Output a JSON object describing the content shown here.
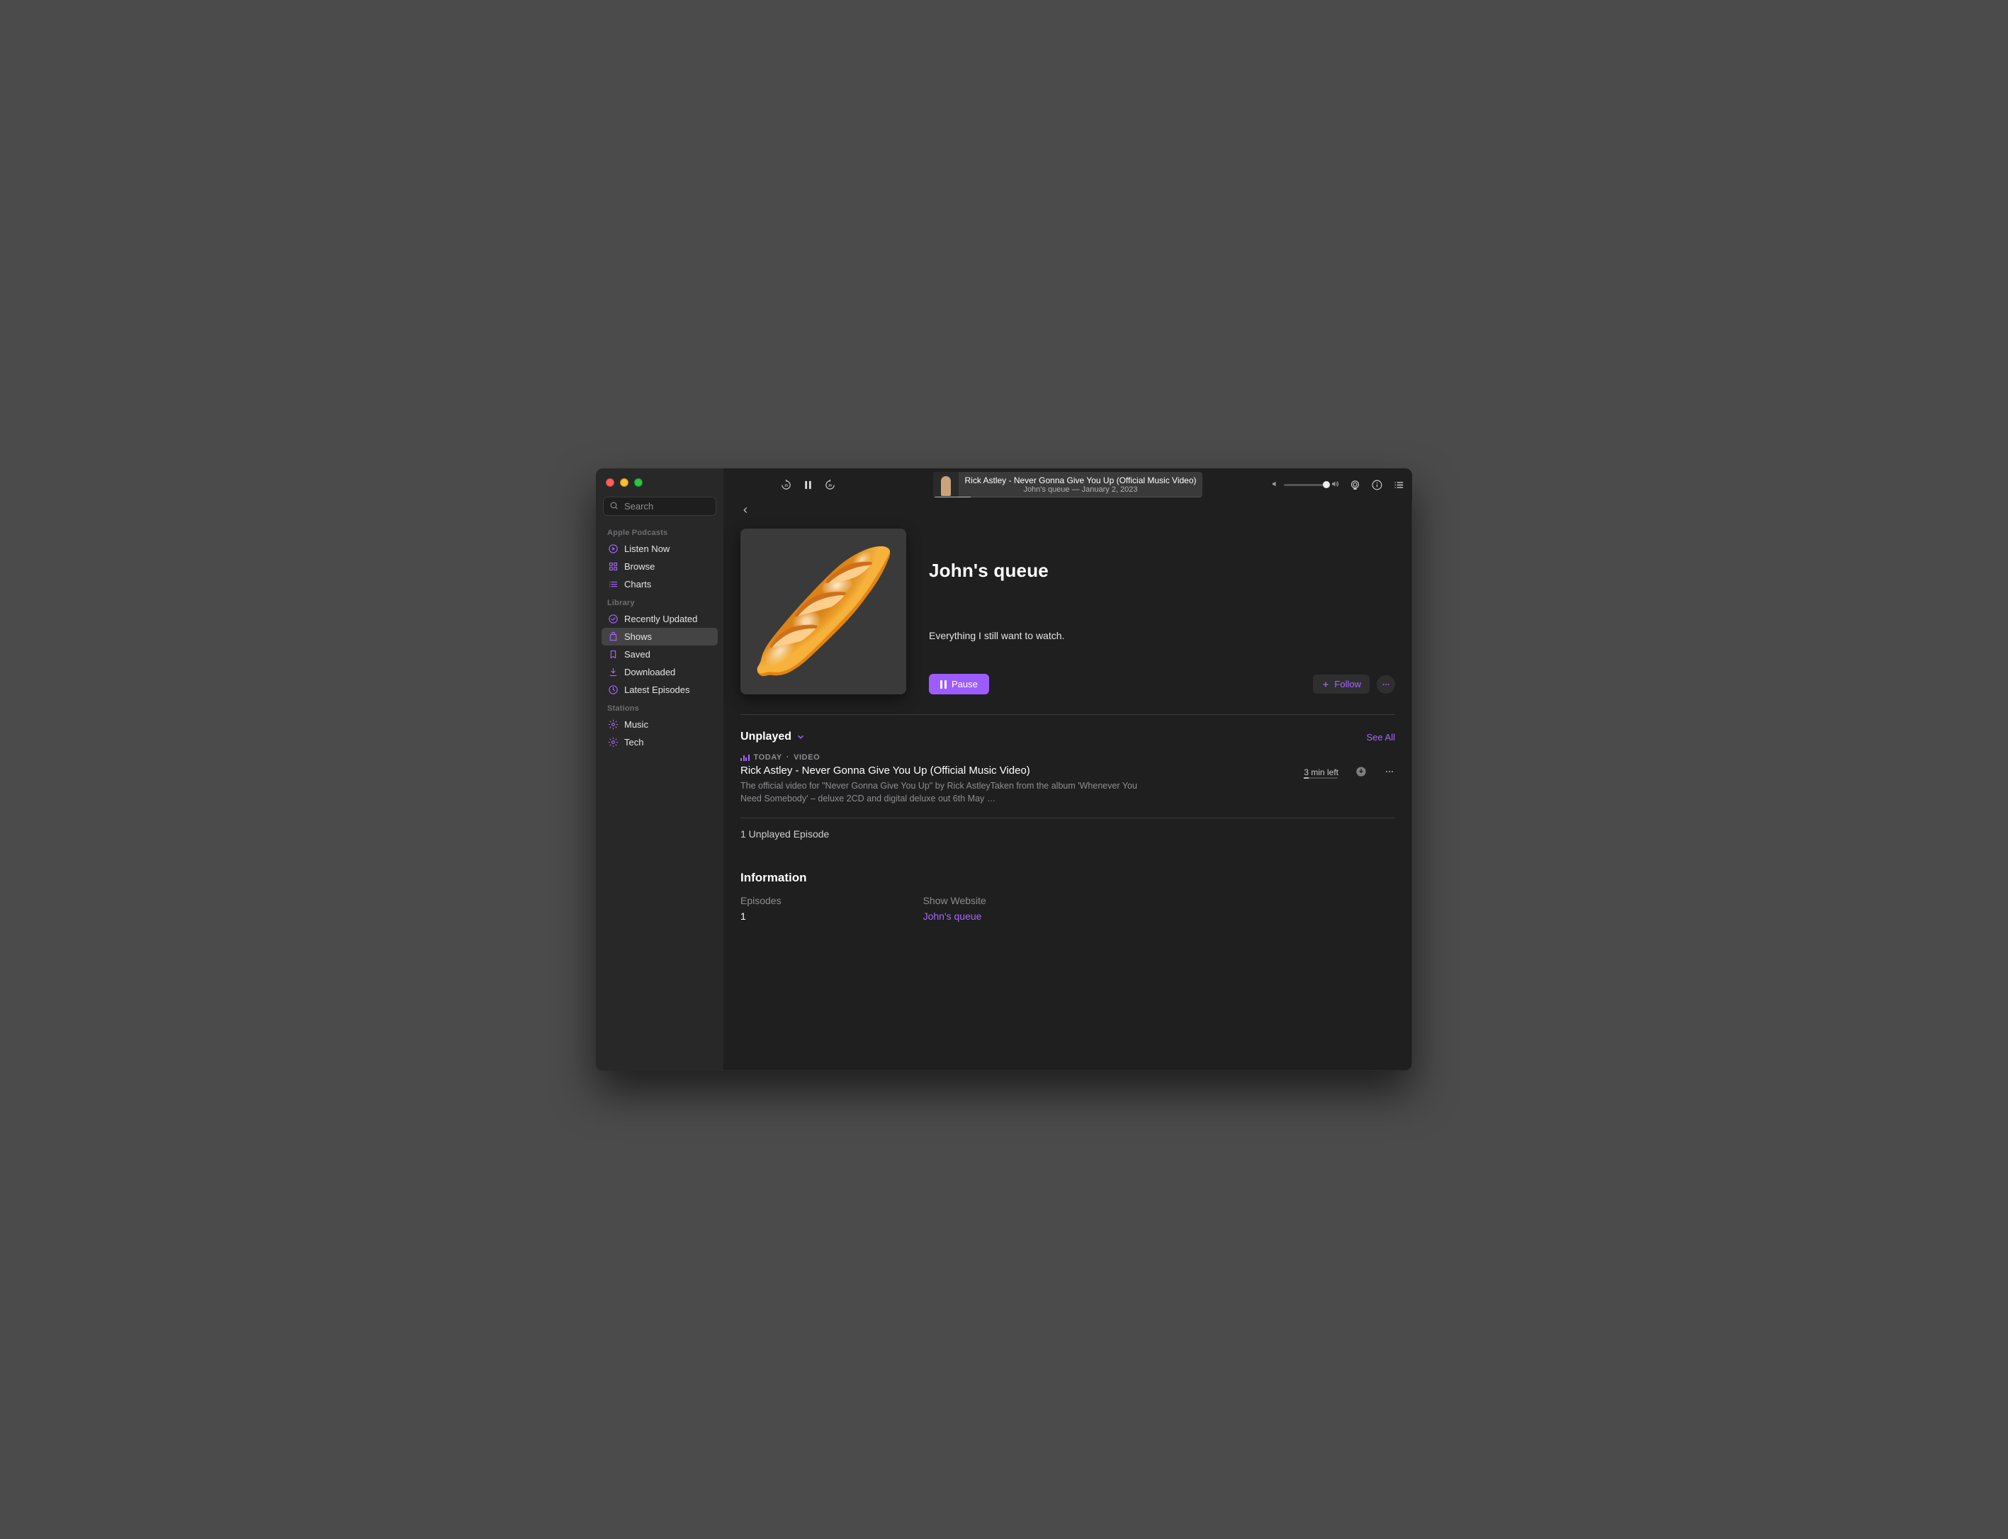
{
  "window": {
    "app": "Podcasts"
  },
  "search": {
    "placeholder": "Search"
  },
  "sidebar": {
    "sections": [
      {
        "title": "Apple Podcasts",
        "items": [
          {
            "icon": "play-circle-icon",
            "label": "Listen Now"
          },
          {
            "icon": "grid-icon",
            "label": "Browse"
          },
          {
            "icon": "list-icon",
            "label": "Charts"
          }
        ]
      },
      {
        "title": "Library",
        "items": [
          {
            "icon": "clock-check-icon",
            "label": "Recently Updated"
          },
          {
            "icon": "bag-icon",
            "label": "Shows",
            "selected": true
          },
          {
            "icon": "bookmark-icon",
            "label": "Saved"
          },
          {
            "icon": "download-icon",
            "label": "Downloaded"
          },
          {
            "icon": "clock-icon",
            "label": "Latest Episodes"
          }
        ]
      },
      {
        "title": "Stations",
        "items": [
          {
            "icon": "gear-icon",
            "label": "Music"
          },
          {
            "icon": "gear-icon",
            "label": "Tech"
          }
        ]
      }
    ]
  },
  "player": {
    "back15": "15",
    "fwd30": "30",
    "now_playing_title": "Rick Astley - Never Gonna Give You Up (Official Music Video)",
    "now_playing_subtitle": "John's queue — January 2, 2023",
    "progress_pct": 14,
    "volume_pct": 100
  },
  "show": {
    "title": "John's queue",
    "description": "Everything I still want to watch.",
    "artwork_emoji": "🥖",
    "pause_label": "Pause",
    "follow_label": "Follow"
  },
  "episodes": {
    "filter_label": "Unplayed",
    "see_all_label": "See All",
    "items": [
      {
        "kicker_date": "TODAY",
        "kicker_kind": "VIDEO",
        "title": "Rick Astley - Never Gonna Give You Up (Official Music Video)",
        "description": "The official video for \"Never Gonna Give You Up\" by Rick AstleyTaken from the album 'Whenever You Need Somebody' – deluxe 2CD and digital deluxe out 6th May …",
        "time_left": "3 min left",
        "progress_pct": 14
      }
    ],
    "unplayed_summary": "1 Unplayed Episode"
  },
  "info": {
    "heading": "Information",
    "episodes_label": "Episodes",
    "episodes_value": "1",
    "website_label": "Show Website",
    "website_value": "John's queue"
  }
}
